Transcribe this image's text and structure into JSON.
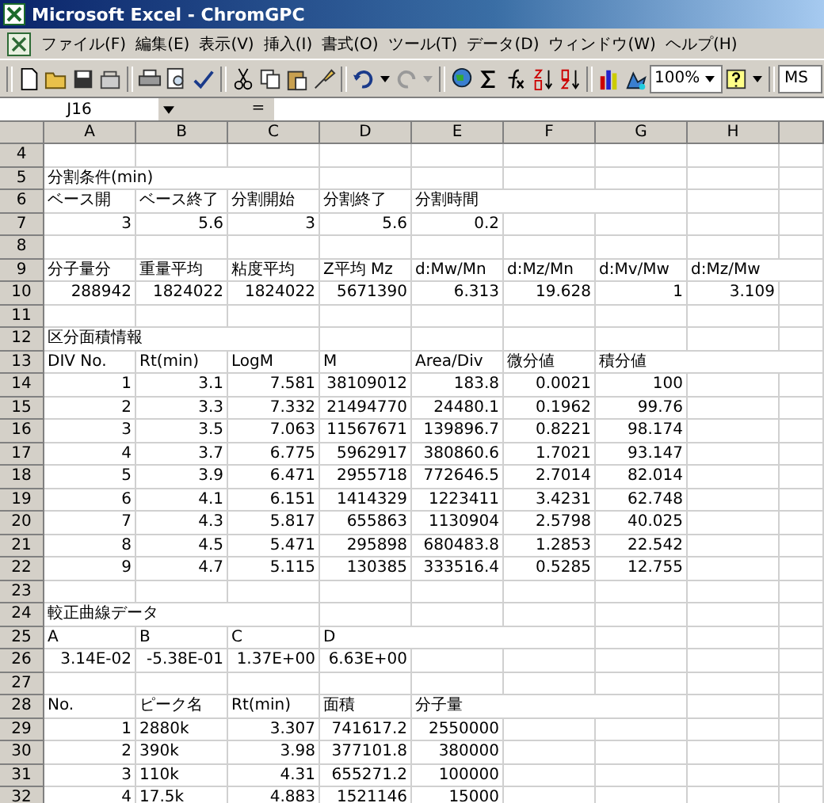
{
  "window": {
    "title": "Microsoft Excel - ChromGPC"
  },
  "menu": [
    "ファイル(F)",
    "編集(E)",
    "表示(V)",
    "挿入(I)",
    "書式(O)",
    "ツール(T)",
    "データ(D)",
    "ウィンドウ(W)",
    "ヘルプ(H)"
  ],
  "toolbar": {
    "zoom": "100%",
    "font": "MS"
  },
  "formula_bar": {
    "name_box": "J16",
    "equals": "="
  },
  "columns": [
    "A",
    "B",
    "C",
    "D",
    "E",
    "F",
    "G",
    "H"
  ],
  "rows": [
    {
      "number": "4"
    },
    {
      "number": "5",
      "cells": {
        "A": {
          "text": "分割条件(min)",
          "kind": "text"
        }
      }
    },
    {
      "number": "6",
      "cells": {
        "A": {
          "text": "ベース開",
          "kind": "text"
        },
        "B": {
          "text": "ベース終了",
          "kind": "text"
        },
        "C": {
          "text": "分割開始",
          "kind": "text"
        },
        "D": {
          "text": "分割終了",
          "kind": "text"
        },
        "E": {
          "text": "分割時間",
          "kind": "text"
        }
      }
    },
    {
      "number": "7",
      "cells": {
        "A": {
          "text": "3",
          "kind": "number"
        },
        "B": {
          "text": "5.6",
          "kind": "number"
        },
        "C": {
          "text": "3",
          "kind": "number"
        },
        "D": {
          "text": "5.6",
          "kind": "number"
        },
        "E": {
          "text": "0.2",
          "kind": "number"
        }
      }
    },
    {
      "number": "8"
    },
    {
      "number": "9",
      "cells": {
        "A": {
          "text": "分子量分",
          "kind": "text"
        },
        "B": {
          "text": "重量平均",
          "kind": "text"
        },
        "C": {
          "text": "粘度平均",
          "kind": "text"
        },
        "D": {
          "text": "Z平均 Mz",
          "kind": "text"
        },
        "E": {
          "text": "d:Mw/Mn",
          "kind": "text"
        },
        "F": {
          "text": "d:Mz/Mn",
          "kind": "text"
        },
        "G": {
          "text": "d:Mv/Mw",
          "kind": "text"
        },
        "H": {
          "text": "d:Mz/Mw",
          "kind": "text"
        }
      }
    },
    {
      "number": "10",
      "cells": {
        "A": {
          "text": "288942",
          "kind": "number"
        },
        "B": {
          "text": "1824022",
          "kind": "number"
        },
        "C": {
          "text": "1824022",
          "kind": "number"
        },
        "D": {
          "text": "5671390",
          "kind": "number"
        },
        "E": {
          "text": "6.313",
          "kind": "number"
        },
        "F": {
          "text": "19.628",
          "kind": "number"
        },
        "G": {
          "text": "1",
          "kind": "number"
        },
        "H": {
          "text": "3.109",
          "kind": "number"
        }
      }
    },
    {
      "number": "11"
    },
    {
      "number": "12",
      "cells": {
        "A": {
          "text": "区分面積情報",
          "kind": "text"
        }
      }
    },
    {
      "number": "13",
      "cells": {
        "A": {
          "text": "DIV No.",
          "kind": "text"
        },
        "B": {
          "text": "Rt(min)",
          "kind": "text"
        },
        "C": {
          "text": "LogM",
          "kind": "text"
        },
        "D": {
          "text": "M",
          "kind": "text"
        },
        "E": {
          "text": "Area/Div",
          "kind": "text"
        },
        "F": {
          "text": "微分値",
          "kind": "text"
        },
        "G": {
          "text": "積分値",
          "kind": "text"
        }
      }
    },
    {
      "number": "14",
      "cells": {
        "A": {
          "text": "1",
          "kind": "number"
        },
        "B": {
          "text": "3.1",
          "kind": "number"
        },
        "C": {
          "text": "7.581",
          "kind": "number"
        },
        "D": {
          "text": "38109012",
          "kind": "number"
        },
        "E": {
          "text": "183.8",
          "kind": "number"
        },
        "F": {
          "text": "0.0021",
          "kind": "number"
        },
        "G": {
          "text": "100",
          "kind": "number"
        }
      }
    },
    {
      "number": "15",
      "cells": {
        "A": {
          "text": "2",
          "kind": "number"
        },
        "B": {
          "text": "3.3",
          "kind": "number"
        },
        "C": {
          "text": "7.332",
          "kind": "number"
        },
        "D": {
          "text": "21494770",
          "kind": "number"
        },
        "E": {
          "text": "24480.1",
          "kind": "number"
        },
        "F": {
          "text": "0.1962",
          "kind": "number"
        },
        "G": {
          "text": "99.76",
          "kind": "number"
        }
      }
    },
    {
      "number": "16",
      "cells": {
        "A": {
          "text": "3",
          "kind": "number"
        },
        "B": {
          "text": "3.5",
          "kind": "number"
        },
        "C": {
          "text": "7.063",
          "kind": "number"
        },
        "D": {
          "text": "11567671",
          "kind": "number"
        },
        "E": {
          "text": "139896.7",
          "kind": "number"
        },
        "F": {
          "text": "0.8221",
          "kind": "number"
        },
        "G": {
          "text": "98.174",
          "kind": "number"
        }
      }
    },
    {
      "number": "17",
      "cells": {
        "A": {
          "text": "4",
          "kind": "number"
        },
        "B": {
          "text": "3.7",
          "kind": "number"
        },
        "C": {
          "text": "6.775",
          "kind": "number"
        },
        "D": {
          "text": "5962917",
          "kind": "number"
        },
        "E": {
          "text": "380860.6",
          "kind": "number"
        },
        "F": {
          "text": "1.7021",
          "kind": "number"
        },
        "G": {
          "text": "93.147",
          "kind": "number"
        }
      }
    },
    {
      "number": "18",
      "cells": {
        "A": {
          "text": "5",
          "kind": "number"
        },
        "B": {
          "text": "3.9",
          "kind": "number"
        },
        "C": {
          "text": "6.471",
          "kind": "number"
        },
        "D": {
          "text": "2955718",
          "kind": "number"
        },
        "E": {
          "text": "772646.5",
          "kind": "number"
        },
        "F": {
          "text": "2.7014",
          "kind": "number"
        },
        "G": {
          "text": "82.014",
          "kind": "number"
        }
      }
    },
    {
      "number": "19",
      "cells": {
        "A": {
          "text": "6",
          "kind": "number"
        },
        "B": {
          "text": "4.1",
          "kind": "number"
        },
        "C": {
          "text": "6.151",
          "kind": "number"
        },
        "D": {
          "text": "1414329",
          "kind": "number"
        },
        "E": {
          "text": "1223411",
          "kind": "number"
        },
        "F": {
          "text": "3.4231",
          "kind": "number"
        },
        "G": {
          "text": "62.748",
          "kind": "number"
        }
      }
    },
    {
      "number": "20",
      "cells": {
        "A": {
          "text": "7",
          "kind": "number"
        },
        "B": {
          "text": "4.3",
          "kind": "number"
        },
        "C": {
          "text": "5.817",
          "kind": "number"
        },
        "D": {
          "text": "655863",
          "kind": "number"
        },
        "E": {
          "text": "1130904",
          "kind": "number"
        },
        "F": {
          "text": "2.5798",
          "kind": "number"
        },
        "G": {
          "text": "40.025",
          "kind": "number"
        }
      }
    },
    {
      "number": "21",
      "cells": {
        "A": {
          "text": "8",
          "kind": "number"
        },
        "B": {
          "text": "4.5",
          "kind": "number"
        },
        "C": {
          "text": "5.471",
          "kind": "number"
        },
        "D": {
          "text": "295898",
          "kind": "number"
        },
        "E": {
          "text": "680483.8",
          "kind": "number"
        },
        "F": {
          "text": "1.2853",
          "kind": "number"
        },
        "G": {
          "text": "22.542",
          "kind": "number"
        }
      }
    },
    {
      "number": "22",
      "cells": {
        "A": {
          "text": "9",
          "kind": "number"
        },
        "B": {
          "text": "4.7",
          "kind": "number"
        },
        "C": {
          "text": "5.115",
          "kind": "number"
        },
        "D": {
          "text": "130385",
          "kind": "number"
        },
        "E": {
          "text": "333516.4",
          "kind": "number"
        },
        "F": {
          "text": "0.5285",
          "kind": "number"
        },
        "G": {
          "text": "12.755",
          "kind": "number"
        }
      }
    },
    {
      "number": "23"
    },
    {
      "number": "24",
      "cells": {
        "A": {
          "text": "較正曲線データ",
          "kind": "text"
        }
      }
    },
    {
      "number": "25",
      "cells": {
        "A": {
          "text": "A",
          "kind": "text"
        },
        "B": {
          "text": "B",
          "kind": "text"
        },
        "C": {
          "text": "C",
          "kind": "text"
        },
        "D": {
          "text": "D",
          "kind": "text"
        }
      }
    },
    {
      "number": "26",
      "cells": {
        "A": {
          "text": "3.14E-02",
          "kind": "number"
        },
        "B": {
          "text": "-5.38E-01",
          "kind": "number"
        },
        "C": {
          "text": "1.37E+00",
          "kind": "number"
        },
        "D": {
          "text": "6.63E+00",
          "kind": "number"
        }
      }
    },
    {
      "number": "27"
    },
    {
      "number": "28",
      "cells": {
        "A": {
          "text": "No.",
          "kind": "text"
        },
        "B": {
          "text": "ピーク名",
          "kind": "text"
        },
        "C": {
          "text": "Rt(min)",
          "kind": "text"
        },
        "D": {
          "text": "面積",
          "kind": "text"
        },
        "E": {
          "text": "分子量",
          "kind": "text"
        }
      }
    },
    {
      "number": "29",
      "cells": {
        "A": {
          "text": "1",
          "kind": "number"
        },
        "B": {
          "text": "2880k",
          "kind": "text"
        },
        "C": {
          "text": "3.307",
          "kind": "number"
        },
        "D": {
          "text": "741617.2",
          "kind": "number"
        },
        "E": {
          "text": "2550000",
          "kind": "number"
        }
      }
    },
    {
      "number": "30",
      "cells": {
        "A": {
          "text": "2",
          "kind": "number"
        },
        "B": {
          "text": "390k",
          "kind": "text"
        },
        "C": {
          "text": "3.98",
          "kind": "number"
        },
        "D": {
          "text": "377101.8",
          "kind": "number"
        },
        "E": {
          "text": "380000",
          "kind": "number"
        }
      }
    },
    {
      "number": "31",
      "cells": {
        "A": {
          "text": "3",
          "kind": "number"
        },
        "B": {
          "text": "110k",
          "kind": "text"
        },
        "C": {
          "text": "4.31",
          "kind": "number"
        },
        "D": {
          "text": "655271.2",
          "kind": "number"
        },
        "E": {
          "text": "100000",
          "kind": "number"
        }
      }
    },
    {
      "number": "32",
      "cells": {
        "A": {
          "text": "4",
          "kind": "number"
        },
        "B": {
          "text": "17.5k",
          "kind": "text"
        },
        "C": {
          "text": "4.883",
          "kind": "number"
        },
        "D": {
          "text": "1521146",
          "kind": "number"
        },
        "E": {
          "text": "15000",
          "kind": "number"
        }
      }
    }
  ]
}
